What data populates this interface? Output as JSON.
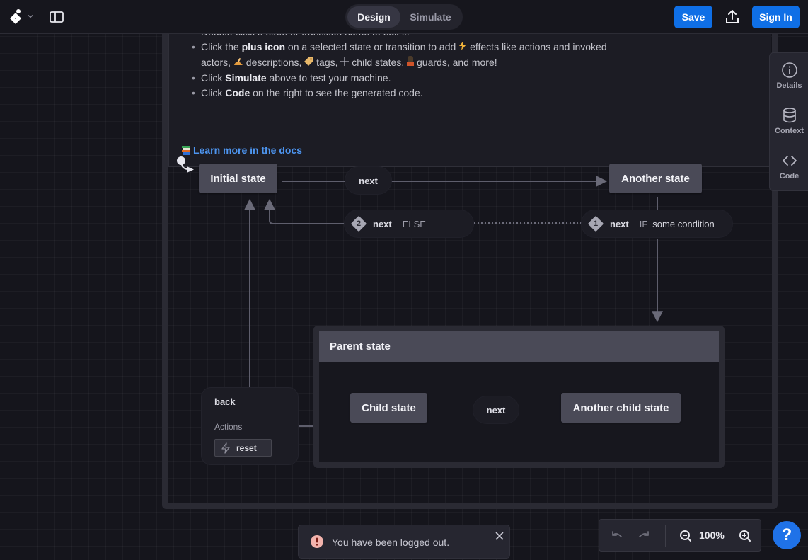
{
  "header": {
    "mode_tabs": [
      {
        "label": "Design",
        "active": true
      },
      {
        "label": "Simulate",
        "active": false
      }
    ],
    "save_label": "Save",
    "signin_label": "Sign In",
    "accent_color": "#0f6fe6"
  },
  "welcome": {
    "items": [
      {
        "parts": [
          {
            "text": "Double-click a state or transition name to edit it."
          }
        ]
      },
      {
        "parts": [
          {
            "text": "Click the "
          },
          {
            "text": "plus icon",
            "bold": true
          },
          {
            "text": " on a selected state or transition to add "
          },
          {
            "emoji": "lightning-icon"
          },
          {
            "text": " effects like actions and invoked"
          }
        ]
      },
      {
        "parts": [
          {
            "text": "actors, "
          },
          {
            "emoji": "writing-hand-icon"
          },
          {
            "text": " descriptions, "
          },
          {
            "emoji": "tag-icon"
          },
          {
            "text": " tags, "
          },
          {
            "emoji": "plus-icon"
          },
          {
            "text": " child states, "
          },
          {
            "emoji": "guard-icon"
          },
          {
            "text": " guards, and more!"
          }
        ],
        "continuation": true
      },
      {
        "parts": [
          {
            "text": "Click "
          },
          {
            "text": "Simulate",
            "bold": true
          },
          {
            "text": " above to test your machine."
          }
        ]
      },
      {
        "parts": [
          {
            "text": "Click "
          },
          {
            "text": "Code",
            "bold": true
          },
          {
            "text": " on the right to see the generated code."
          }
        ]
      }
    ],
    "docs_link": "Learn more in the docs"
  },
  "machine": {
    "states": {
      "initial": "Initial state",
      "another": "Another state",
      "parent": "Parent state",
      "child": "Child state",
      "another_child": "Another child state"
    },
    "transitions": {
      "initial_next": "next",
      "guarded_1": {
        "order": "1",
        "event": "next",
        "keyword": "IF",
        "condition": "some condition"
      },
      "guarded_2": {
        "order": "2",
        "event": "next",
        "keyword": "ELSE"
      },
      "child_next": "next",
      "back": {
        "event": "back",
        "actions_label": "Actions",
        "action": "reset"
      }
    }
  },
  "right_rail": {
    "items": [
      {
        "label": "Details",
        "icon": "info-icon"
      },
      {
        "label": "Context",
        "icon": "database-icon"
      },
      {
        "label": "Code",
        "icon": "code-icon"
      }
    ]
  },
  "toast": {
    "message": "You have been logged out.",
    "icon": "alert-icon"
  },
  "zoom": {
    "level": "100%"
  },
  "help": {
    "label": "?"
  }
}
